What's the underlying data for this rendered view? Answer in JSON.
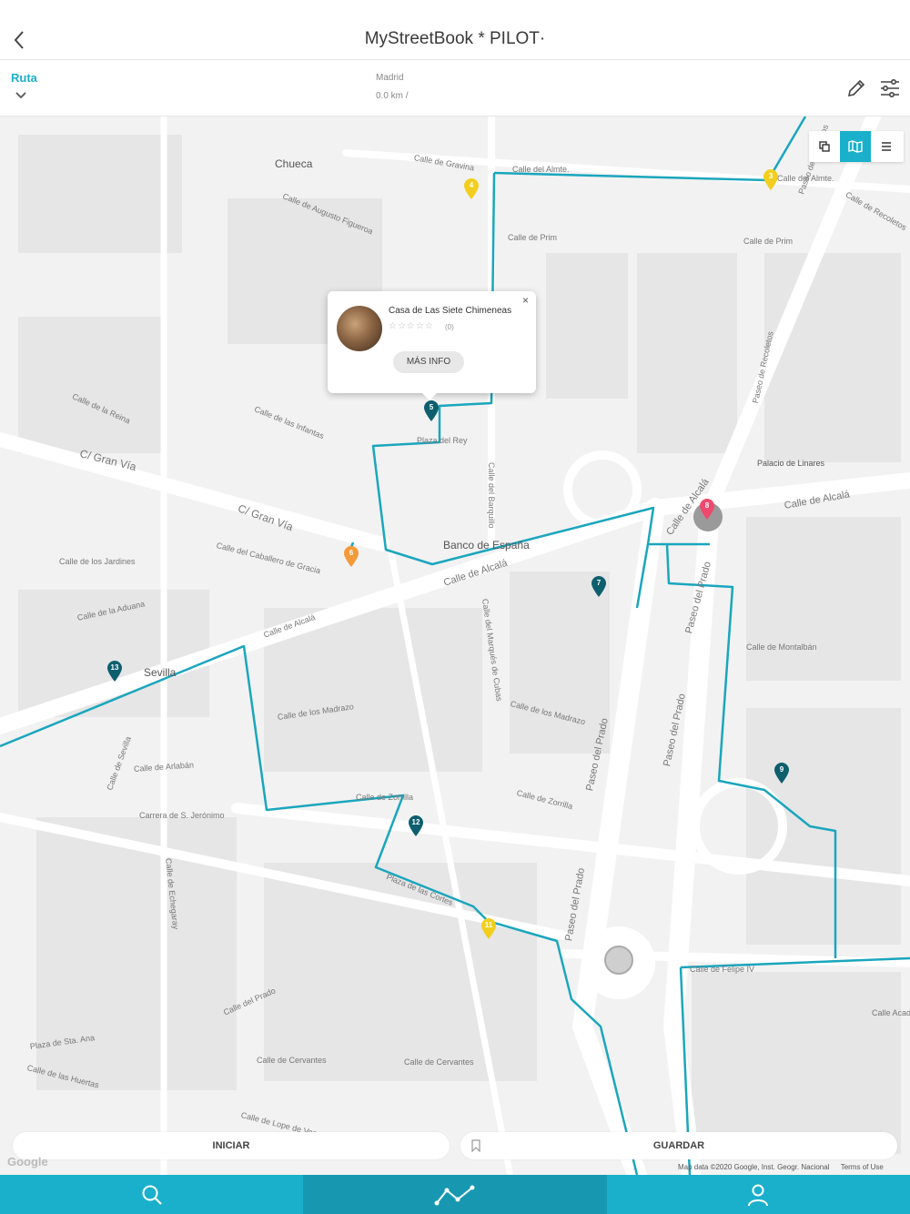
{
  "header": {
    "title": "MyStreetBook * PILOT·",
    "back_icon": "chevron-left-icon"
  },
  "routebar": {
    "tab_label": "Ruta",
    "city": "Madrid",
    "distance": "0.0 km /",
    "edit_icon": "pencil-icon",
    "filter_icon": "sliders-icon"
  },
  "map": {
    "tools": [
      "layers-icon",
      "map-icon",
      "list-icon"
    ],
    "places": [
      "Chueca",
      "Banco de España",
      "Sevilla",
      "Palacio de Linares"
    ],
    "streets": [
      "Calle de Gravina",
      "Calle del Almte.",
      "Calle del Almte.",
      "Calle de Augusto Figueroa",
      "Calle de Prim",
      "Calle de Prim",
      "Calle de las Infantas",
      "Plaza del Rey",
      "C/ Gran Vía",
      "C/ Gran Vía",
      "Calle del Caballero de Gracia",
      "Calle de Alcalá",
      "Calle de Alcalá",
      "Calle de Alcalá",
      "Calle de Alcalá",
      "Paseo del Prado",
      "Paseo del Prado",
      "Paseo del Prado",
      "Paseo del Prado",
      "Calle de Montalbán",
      "Calle de los Madrazo",
      "Calle de los Madrazo",
      "Calle de Zorrilla",
      "Calle de Zorrilla",
      "Plaza de las Cortes",
      "Calle de Cervantes",
      "Calle de Cervantes",
      "Carrera de S. Jerónimo",
      "Calle de Arlabán",
      "Calle del Prado",
      "Calle de Felipe IV",
      "Calle de los Jardines",
      "Calle de la Aduana",
      "Calle de la Reina",
      "Paseo de Recoletos",
      "Calle de Lope de Vega",
      "Calle del Marqués de Cubas",
      "Calle del Barquillo",
      "Calle de Sevilla",
      "Calle de Echegaray",
      "Calle de las Huertas",
      "Plaza de Sta. Ana",
      "Calle Academia",
      "Calle de Recoletos",
      "Paseo de Recoletos"
    ]
  },
  "markers": [
    {
      "num": "3",
      "color": "#f2cf1e"
    },
    {
      "num": "4",
      "color": "#f2cf1e"
    },
    {
      "num": "5",
      "color": "#0e5f6e"
    },
    {
      "num": "6",
      "color": "#f39a3a"
    },
    {
      "num": "7",
      "color": "#0e5f6e"
    },
    {
      "num": "8",
      "color": "#ee4a6e"
    },
    {
      "num": "9",
      "color": "#0e5f6e"
    },
    {
      "num": "11",
      "color": "#f2cf1e"
    },
    {
      "num": "12",
      "color": "#0e5f6e"
    },
    {
      "num": "13",
      "color": "#0e5f6e"
    }
  ],
  "popup": {
    "title": "Casa de Las Siete Chimeneas",
    "stars": "☆☆☆☆☆",
    "count": "(0)",
    "button": "MÁS INFO",
    "close": "×"
  },
  "actions": {
    "start": "INICIAR",
    "save": "GUARDAR",
    "save_icon": "bookmark-icon"
  },
  "map_footer": {
    "google": "Google",
    "attribution": "Map data ©2020 Google, Inst. Geogr. Nacional",
    "terms": "Terms of Use"
  },
  "tabbar": [
    "search-icon",
    "route-icon",
    "user-icon"
  ],
  "colors": {
    "accent": "#1ab0cc",
    "route": "#1aa6bd"
  }
}
